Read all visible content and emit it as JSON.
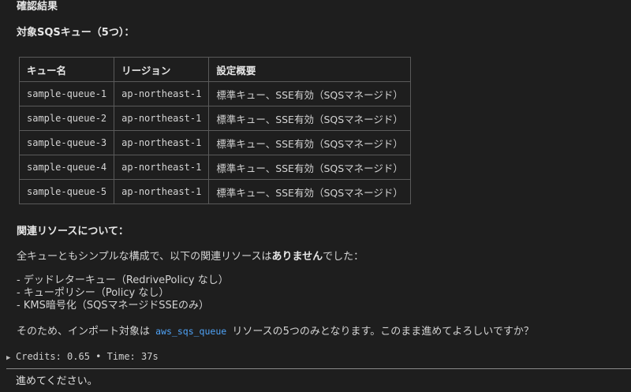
{
  "headings": {
    "confirm": "確認結果",
    "target": "対象SQSキュー（5つ）：",
    "related": "関連リソースについて："
  },
  "table": {
    "headers": [
      "キュー名",
      "リージョン",
      "設定概要"
    ],
    "rows": [
      [
        "sample-queue-1",
        "ap-northeast-1",
        "標準キュー、SSE有効（SQSマネージド）"
      ],
      [
        "sample-queue-2",
        "ap-northeast-1",
        "標準キュー、SSE有効（SQSマネージド）"
      ],
      [
        "sample-queue-3",
        "ap-northeast-1",
        "標準キュー、SSE有効（SQSマネージド）"
      ],
      [
        "sample-queue-4",
        "ap-northeast-1",
        "標準キュー、SSE有効（SQSマネージド）"
      ],
      [
        "sample-queue-5",
        "ap-northeast-1",
        "標準キュー、SSE有効（SQSマネージド）"
      ]
    ]
  },
  "summary": {
    "before": "全キューともシンプルな構成で、以下の関連リソースは",
    "bold": "ありません",
    "after": "でした："
  },
  "related_items": [
    "- デッドレターキュー（RedrivePolicy なし）",
    "- キューポリシー（Policy なし）",
    "- KMS暗号化（SQSマネージドSSEのみ）"
  ],
  "import_note": {
    "before": "そのため、インポート対象は",
    "code": "aws_sqs_queue",
    "after": "リソースの5つのみとなります。このまま進めてよろしいですか？"
  },
  "status": {
    "credits_label": "Credits:",
    "credits_value": "0.65",
    "separator": "•",
    "time_label": "Time:",
    "time_value": "37s"
  },
  "user_message": "進めてください。",
  "colors": {
    "background": "#1e1e1e",
    "text": "#d4d4d4",
    "code_accent": "#4fa3f7",
    "border": "#5a5a5a"
  }
}
